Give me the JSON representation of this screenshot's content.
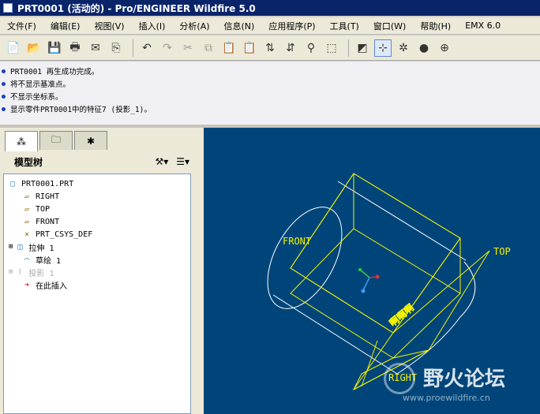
{
  "window": {
    "title": "PRT0001 (活动的) - Pro/ENGINEER Wildfire 5.0"
  },
  "menu": [
    "文件(F)",
    "编辑(E)",
    "视图(V)",
    "插入(I)",
    "分析(A)",
    "信息(N)",
    "应用程序(P)",
    "工具(T)",
    "窗口(W)",
    "帮助(H)",
    "EMX 6.0"
  ],
  "messages": [
    "PRT0001 再生成功完成。",
    "将不显示基准点。",
    "不显示坐标系。",
    "显示零件PRT0001中的特征7 (投影_1)。"
  ],
  "panel": {
    "title": "模型树"
  },
  "tree": [
    {
      "label": "PRT0001.PRT",
      "icon": "part-icon"
    },
    {
      "label": "RIGHT",
      "icon": "datum-plane-icon"
    },
    {
      "label": "TOP",
      "icon": "datum-plane-icon"
    },
    {
      "label": "FRONT",
      "icon": "datum-plane-icon"
    },
    {
      "label": "PRT_CSYS_DEF",
      "icon": "csys-icon"
    },
    {
      "label": "拉伸 1",
      "icon": "extrude-icon"
    },
    {
      "label": "草绘 1",
      "icon": "sketch-icon"
    },
    {
      "label": "投影 1",
      "icon": "projection-icon"
    },
    {
      "label": "在此插入",
      "icon": "insert-here-icon"
    }
  ],
  "viewport": {
    "labels": {
      "front": "FRONT",
      "top": "TOP",
      "right": "RIGHT"
    },
    "projected_text": "啊啊啊",
    "background": "#00457a",
    "datum_color": "#f4f400"
  },
  "watermark": {
    "title": "野火论坛",
    "url": "www.proewildfire.cn"
  }
}
